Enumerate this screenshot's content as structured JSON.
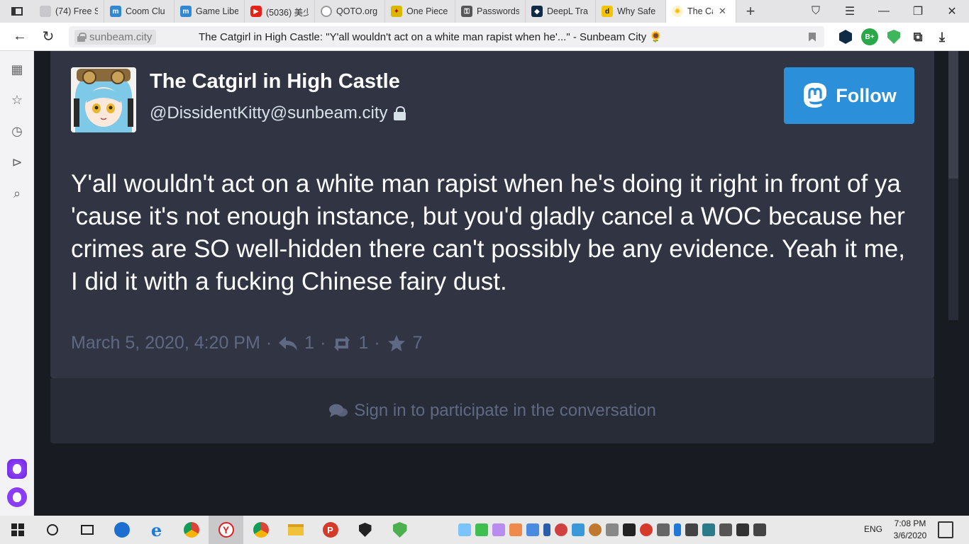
{
  "browser": {
    "tabs": [
      {
        "label": "(74) Free S",
        "icon": "generic-tab-icon",
        "color": "#c8c8cc"
      },
      {
        "label": "Coom Clu",
        "icon": "mastodon-icon",
        "color": "#3088d4"
      },
      {
        "label": "Game Libe",
        "icon": "mastodon-icon",
        "color": "#3088d4"
      },
      {
        "label": "(5036) 美少",
        "icon": "youtube-icon",
        "color": "#e62117"
      },
      {
        "label": "QOTO.org",
        "icon": "qoto-icon",
        "color": "#9a9a9a"
      },
      {
        "label": "One Piece",
        "icon": "onepiece-icon",
        "color": "#d9b800"
      },
      {
        "label": "Passwords",
        "icon": "password-icon",
        "color": "#555555"
      },
      {
        "label": "DeepL Tra",
        "icon": "deepl-icon",
        "color": "#0f2b46"
      },
      {
        "label": "Why Safe",
        "icon": "d-letter-icon",
        "color": "#f2c500"
      },
      {
        "label": "The Ca",
        "icon": "sunbeam-icon",
        "color": "#f6d05a"
      }
    ],
    "new_tab_symbol": "+",
    "address": {
      "domain_chip": "sunbeam.city",
      "page_title": "The Catgirl in High Castle: \"Y'all wouldn't act on a white man rapist when he'...\" - Sunbeam City 🌻"
    }
  },
  "profile": {
    "display_name": "The Catgirl in High Castle",
    "account": "@DissidentKitty@sunbeam.city",
    "follow_label": "Follow"
  },
  "status": {
    "content": "Y'all wouldn't act on a white man rapist when he's doing it right in front of ya 'cause it's not enough instance, but you'd gladly cancel a WOC because her crimes are SO well-hidden there can't possibly be any evidence. Yeah it me, I did it with a fucking Chinese fairy dust.",
    "timestamp": "March 5, 2020, 4:20 PM",
    "separator": "·",
    "replies": "1",
    "boosts": "1",
    "favourites": "7"
  },
  "signin": {
    "label": "Sign in to participate in the conversation"
  },
  "taskbar": {
    "language": "ENG",
    "time": "7:08 PM",
    "date": "3/6/2020"
  },
  "colors": {
    "card_bg": "#313543",
    "page_bg": "#191b22",
    "accent": "#2b90d9",
    "muted_text": "#606984"
  }
}
